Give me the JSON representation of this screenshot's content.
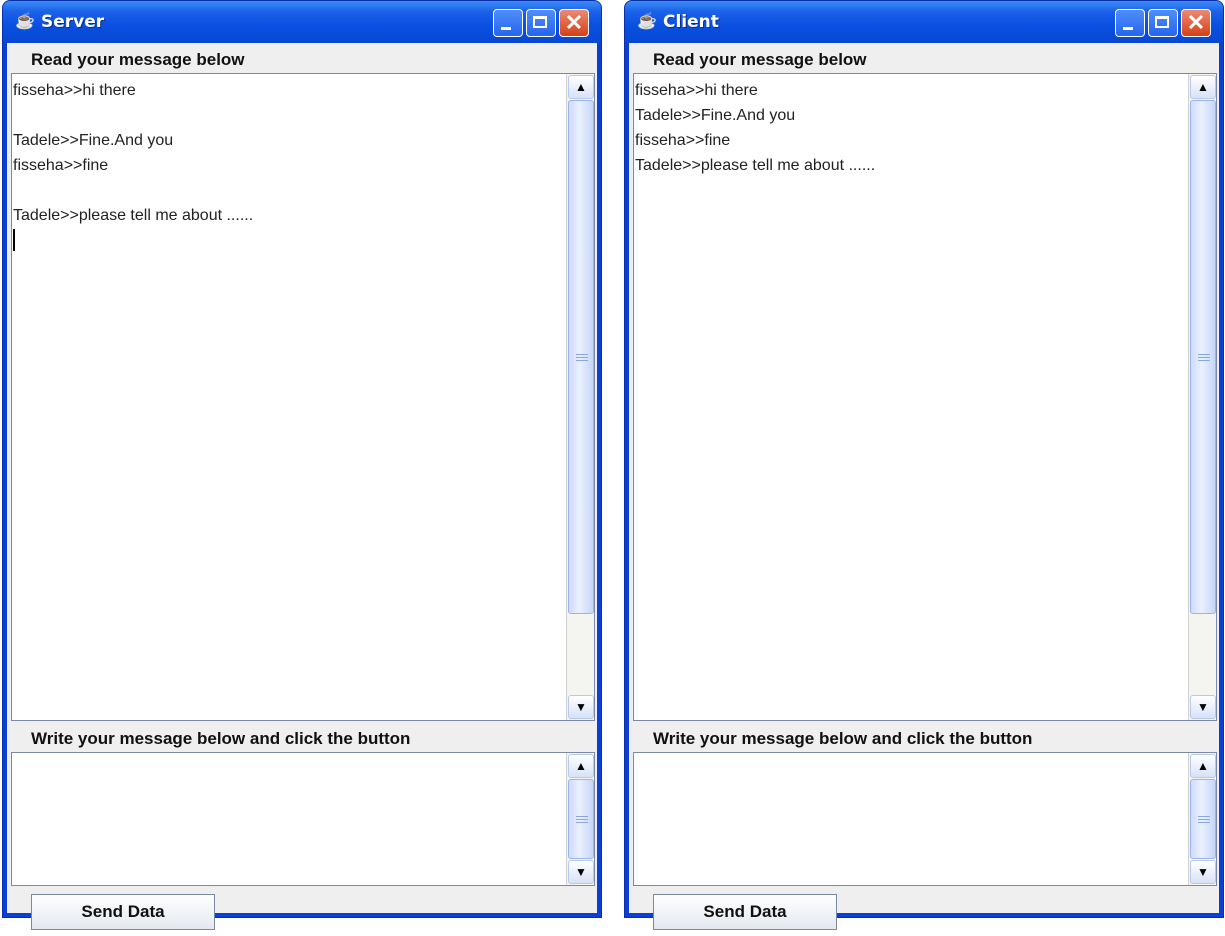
{
  "windows": [
    {
      "title": "Server",
      "read_label": "Read your message below",
      "messages": [
        "fisseha>>hi there",
        "",
        "Tadele>>Fine.And you",
        "fisseha>>fine",
        "",
        "Tadele>>please tell me about ......"
      ],
      "show_caret": true,
      "write_label": "Write your message below and click the button",
      "write_value": "",
      "send_label": "Send Data"
    },
    {
      "title": "Client",
      "read_label": "Read your message below",
      "messages": [
        "fisseha>>hi there",
        "Tadele>>Fine.And you",
        "fisseha>>fine",
        "Tadele>>please tell me about ......"
      ],
      "show_caret": false,
      "write_label": "Write your message below and click the button",
      "write_value": "",
      "send_label": "Send Data"
    }
  ],
  "icons": {
    "app": "java-cup-icon",
    "minimize": "minimize-icon",
    "maximize": "maximize-icon",
    "close": "close-icon",
    "scroll_up": "arrow-up-icon",
    "scroll_down": "arrow-down-icon"
  },
  "colors": {
    "titlebar": "#0a4fe0",
    "close_button": "#d54018",
    "panel": "#efefef",
    "scroll_thumb": "#cfdcfb"
  }
}
